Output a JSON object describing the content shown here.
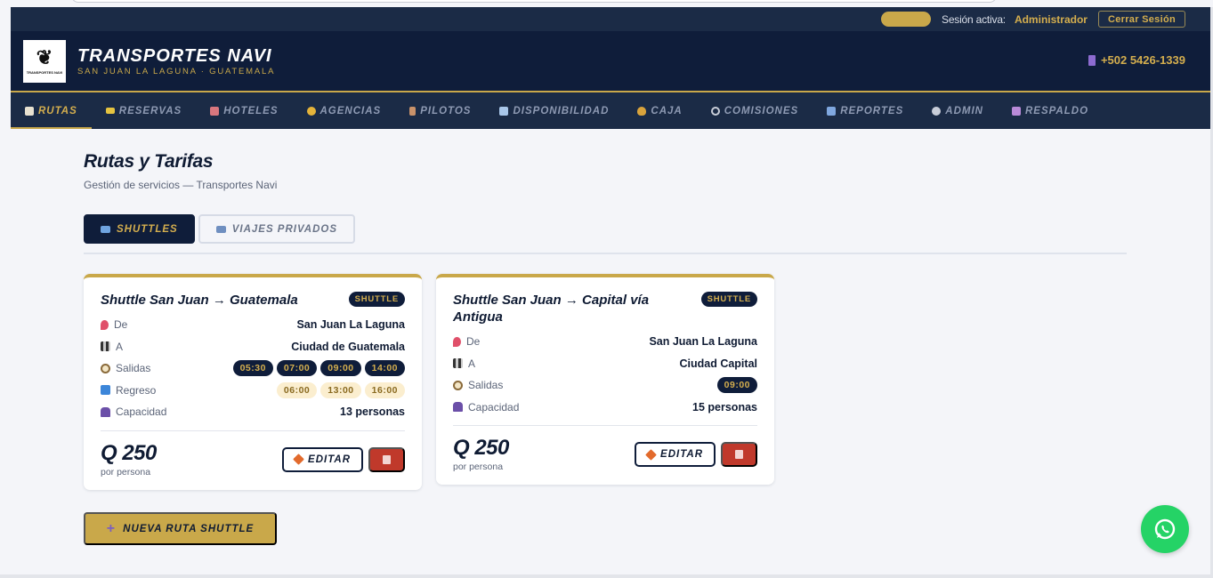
{
  "session": {
    "label": "Sesión activa:",
    "user": "Administrador",
    "logout": "Cerrar Sesión"
  },
  "header": {
    "title": "TRANSPORTES NAVI",
    "subtitle": "SAN JUAN LA LAGUNA · GUATEMALA",
    "logo_text": "TRANSPORTES NAVI",
    "phone": "+502 5426-1339"
  },
  "nav": {
    "items": [
      {
        "label": "RUTAS",
        "icon": "clipboard-icon",
        "color": "#e8e1d0"
      },
      {
        "label": "RESERVAS",
        "icon": "ticket-icon",
        "color": "#e5c340"
      },
      {
        "label": "HOTELES",
        "icon": "hotel-icon",
        "color": "#d9777e"
      },
      {
        "label": "AGENCIAS",
        "icon": "handshake-icon",
        "color": "#e4b33a"
      },
      {
        "label": "PILOTOS",
        "icon": "driver-icon",
        "color": "#c9926a"
      },
      {
        "label": "DISPONIBILIDAD",
        "icon": "calendar-icon",
        "color": "#a9c7ea"
      },
      {
        "label": "CAJA",
        "icon": "money-bag-icon",
        "color": "#d9a33c"
      },
      {
        "label": "COMISIONES",
        "icon": "link-icon",
        "color": "#c8cdd8"
      },
      {
        "label": "REPORTES",
        "icon": "bar-chart-icon",
        "color": "#7fa7df"
      },
      {
        "label": "ADMIN",
        "icon": "gear-icon",
        "color": "#c8cdd8"
      },
      {
        "label": "RESPALDO",
        "icon": "floppy-icon",
        "color": "#b98ad8"
      }
    ]
  },
  "page": {
    "title": "Rutas y Tarifas",
    "subtitle": "Gestión de servicios — Transportes Navi"
  },
  "tabs": {
    "shuttles": "SHUTTLES",
    "private": "VIAJES PRIVADOS"
  },
  "cards": [
    {
      "title": "Shuttle San Juan → Guatemala",
      "badge": "SHUTTLE",
      "from_label": "De",
      "from": "San Juan La Laguna",
      "to_label": "A",
      "to": "Ciudad de Guatemala",
      "departures_label": "Salidas",
      "departures": [
        "05:30",
        "07:00",
        "09:00",
        "14:00"
      ],
      "return_label": "Regreso",
      "returns": [
        "06:00",
        "13:00",
        "16:00"
      ],
      "capacity_label": "Capacidad",
      "capacity": "13 personas",
      "price": "Q 250",
      "price_unit": "por persona",
      "edit_label": "EDITAR"
    },
    {
      "title": "Shuttle San Juan → Capital vía Antigua",
      "badge": "SHUTTLE",
      "from_label": "De",
      "from": "San Juan La Laguna",
      "to_label": "A",
      "to": "Ciudad Capital",
      "departures_label": "Salidas",
      "departures": [
        "09:00"
      ],
      "capacity_label": "Capacidad",
      "capacity": "15 personas",
      "price": "Q 250",
      "price_unit": "por persona",
      "edit_label": "EDITAR"
    }
  ],
  "new_route": "NUEVA RUTA SHUTTLE",
  "colors": {
    "navy": "#0f1d3a",
    "gold": "#c9a84a",
    "danger": "#c0392b",
    "whatsapp": "#25d366"
  }
}
